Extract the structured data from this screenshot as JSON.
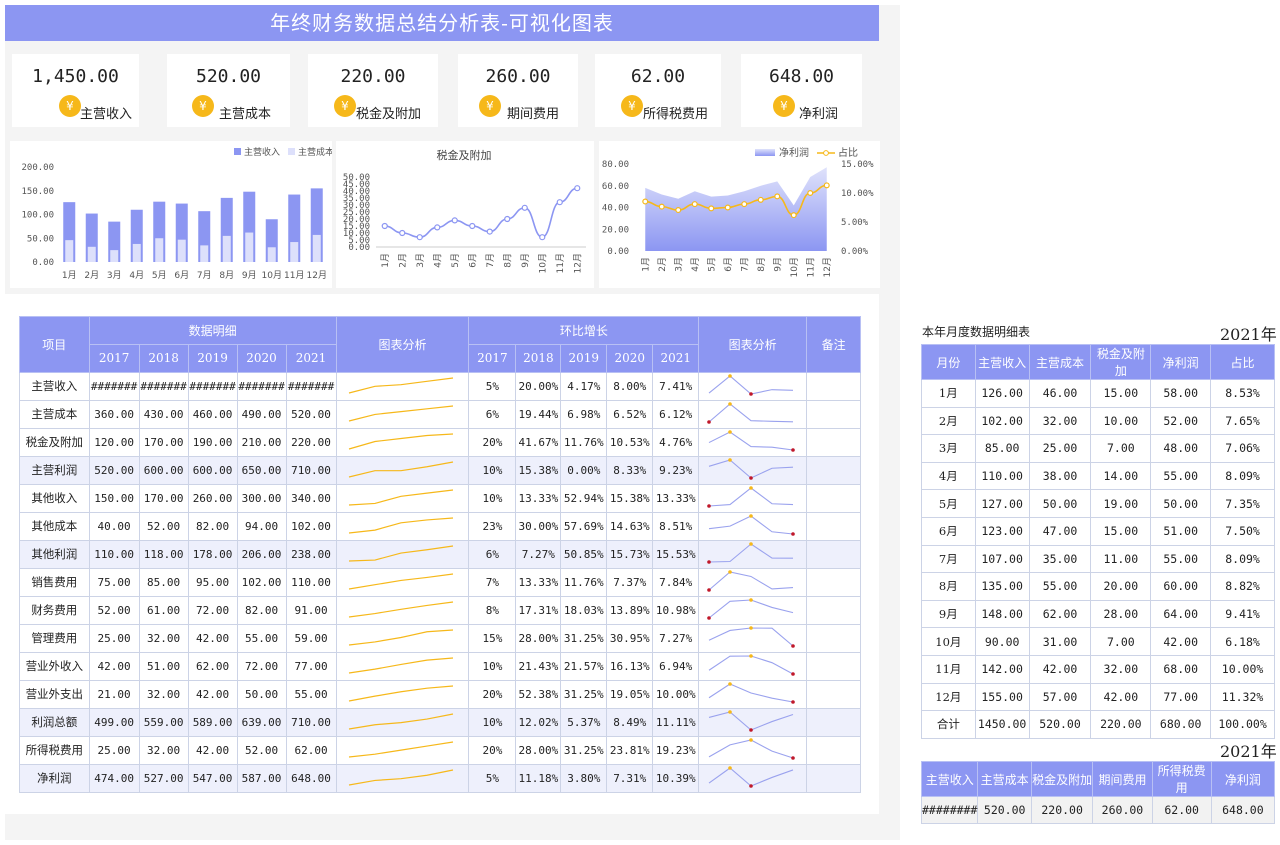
{
  "title": "年终财务数据总结分析表-可视化图表",
  "kpis": [
    {
      "value": "1,450.00",
      "label": "主营收入",
      "icon": "income-icon"
    },
    {
      "value": "520.00",
      "label": "主营成本",
      "icon": "cost-icon"
    },
    {
      "value": "220.00",
      "label": "税金及附加",
      "icon": "tax-icon"
    },
    {
      "value": "260.00",
      "label": "期间费用",
      "icon": "expense-icon"
    },
    {
      "value": "62.00",
      "label": "所得税费用",
      "icon": "income-tax-icon"
    },
    {
      "value": "648.00",
      "label": "净利润",
      "icon": "profit-icon"
    }
  ],
  "colors": {
    "accent": "#8c96f2",
    "bar1": "#8c96f2",
    "bar2": "#dde0fb",
    "line": "#f6b81a",
    "icon": "#f6b81a"
  },
  "chart_data": [
    {
      "type": "bar",
      "categories": [
        "1月",
        "2月",
        "3月",
        "4月",
        "5月",
        "6月",
        "7月",
        "8月",
        "9月",
        "10月",
        "11月",
        "12月"
      ],
      "series": [
        {
          "name": "主营收入",
          "values": [
            126,
            102,
            85,
            110,
            127,
            123,
            107,
            135,
            148,
            90,
            142,
            155
          ]
        },
        {
          "name": "主营成本",
          "values": [
            46,
            32,
            25,
            38,
            50,
            47,
            35,
            55,
            62,
            31,
            42,
            57
          ]
        }
      ],
      "legend_visible": [
        "主营收入",
        "主营成本"
      ],
      "yticks": [
        "0.00",
        "50.00",
        "100.00",
        "150.00",
        "200.00"
      ],
      "ylim": [
        0,
        200
      ],
      "legend": "top-right"
    },
    {
      "type": "line",
      "title": "税金及附加",
      "categories": [
        "1月",
        "2月",
        "3月",
        "4月",
        "5月",
        "6月",
        "7月",
        "8月",
        "9月",
        "10月",
        "11月",
        "12月"
      ],
      "series": [
        {
          "name": "税金及附加",
          "values": [
            15,
            10,
            7,
            14,
            19,
            15,
            11,
            20,
            28,
            7,
            32,
            42
          ]
        }
      ],
      "yticks": [
        "0.00",
        "5.00",
        "10.00",
        "15.00",
        "20.00",
        "25.00",
        "30.00",
        "35.00",
        "40.00",
        "45.00",
        "50.00"
      ],
      "ylim": [
        0,
        50
      ]
    },
    {
      "type": "area",
      "categories": [
        "1月",
        "2月",
        "3月",
        "4月",
        "5月",
        "6月",
        "7月",
        "8月",
        "9月",
        "10月",
        "11月",
        "12月"
      ],
      "series": [
        {
          "name": "净利润",
          "values": [
            58,
            52,
            48,
            55,
            50,
            51,
            55,
            60,
            64,
            42,
            68,
            77
          ]
        },
        {
          "name": "占比",
          "values": [
            8.53,
            7.65,
            7.06,
            8.09,
            7.35,
            7.5,
            8.09,
            8.82,
            9.41,
            6.18,
            10.0,
            11.32
          ]
        }
      ],
      "yticks": [
        "0.00",
        "20.00",
        "40.00",
        "60.00",
        "80.00"
      ],
      "ylim": [
        0,
        80
      ],
      "y2ticks": [
        "0.00%",
        "5.00%",
        "10.00%",
        "15.00%"
      ],
      "y2lim": [
        0,
        15
      ],
      "legend": "top-right"
    }
  ],
  "main_table": {
    "item_header": "项目",
    "detail_header": "数据明细",
    "chart_header": "图表分析",
    "growth_header": "环比增长",
    "chart_header2": "图表分析",
    "note_header": "备注",
    "years": [
      "2017",
      "2018",
      "2019",
      "2020",
      "2021"
    ],
    "rows": [
      {
        "name": "主营收入",
        "vals": [
          "#######",
          "#######",
          "#######",
          "#######",
          "#######"
        ],
        "growth": [
          "5%",
          "20.00%",
          "4.17%",
          "8.00%",
          "7.41%"
        ],
        "spark": [
          1000,
          1200,
          1250,
          1350,
          1450
        ],
        "g": [
          5,
          20,
          4.17,
          8,
          7.41
        ],
        "hl": false
      },
      {
        "name": "主营成本",
        "vals": [
          "360.00",
          "430.00",
          "460.00",
          "490.00",
          "520.00"
        ],
        "growth": [
          "6%",
          "19.44%",
          "6.98%",
          "6.52%",
          "6.12%"
        ],
        "spark": [
          360,
          430,
          460,
          490,
          520
        ],
        "g": [
          6,
          19.44,
          6.98,
          6.52,
          6.12
        ],
        "hl": false
      },
      {
        "name": "税金及附加",
        "vals": [
          "120.00",
          "170.00",
          "190.00",
          "210.00",
          "220.00"
        ],
        "growth": [
          "20%",
          "41.67%",
          "11.76%",
          "10.53%",
          "4.76%"
        ],
        "spark": [
          120,
          170,
          190,
          210,
          220
        ],
        "g": [
          20,
          41.67,
          11.76,
          10.53,
          4.76
        ],
        "hl": false
      },
      {
        "name": "主营利润",
        "vals": [
          "520.00",
          "600.00",
          "600.00",
          "650.00",
          "710.00"
        ],
        "growth": [
          "10%",
          "15.38%",
          "0.00%",
          "8.33%",
          "9.23%"
        ],
        "spark": [
          520,
          600,
          600,
          650,
          710
        ],
        "g": [
          10,
          15.38,
          0,
          8.33,
          9.23
        ],
        "hl": true
      },
      {
        "name": "其他收入",
        "vals": [
          "150.00",
          "170.00",
          "260.00",
          "300.00",
          "340.00"
        ],
        "growth": [
          "10%",
          "13.33%",
          "52.94%",
          "15.38%",
          "13.33%"
        ],
        "spark": [
          150,
          170,
          260,
          300,
          340
        ],
        "g": [
          10,
          13.33,
          52.94,
          15.38,
          13.33
        ],
        "hl": false
      },
      {
        "name": "其他成本",
        "vals": [
          "40.00",
          "52.00",
          "82.00",
          "94.00",
          "102.00"
        ],
        "growth": [
          "23%",
          "30.00%",
          "57.69%",
          "14.63%",
          "8.51%"
        ],
        "spark": [
          40,
          52,
          82,
          94,
          102
        ],
        "g": [
          23,
          30,
          57.69,
          14.63,
          8.51
        ],
        "hl": false
      },
      {
        "name": "其他利润",
        "vals": [
          "110.00",
          "118.00",
          "178.00",
          "206.00",
          "238.00"
        ],
        "growth": [
          "6%",
          "7.27%",
          "50.85%",
          "15.73%",
          "15.53%"
        ],
        "spark": [
          110,
          118,
          178,
          206,
          238
        ],
        "g": [
          6,
          7.27,
          50.85,
          15.73,
          15.53
        ],
        "hl": true
      },
      {
        "name": "销售费用",
        "vals": [
          "75.00",
          "85.00",
          "95.00",
          "102.00",
          "110.00"
        ],
        "growth": [
          "7%",
          "13.33%",
          "11.76%",
          "7.37%",
          "7.84%"
        ],
        "spark": [
          75,
          85,
          95,
          102,
          110
        ],
        "g": [
          7,
          13.33,
          11.76,
          7.37,
          7.84
        ],
        "hl": false
      },
      {
        "name": "财务费用",
        "vals": [
          "52.00",
          "61.00",
          "72.00",
          "82.00",
          "91.00"
        ],
        "growth": [
          "8%",
          "17.31%",
          "18.03%",
          "13.89%",
          "10.98%"
        ],
        "spark": [
          52,
          61,
          72,
          82,
          91
        ],
        "g": [
          8,
          17.31,
          18.03,
          13.89,
          10.98
        ],
        "hl": false
      },
      {
        "name": "管理费用",
        "vals": [
          "25.00",
          "32.00",
          "42.00",
          "55.00",
          "59.00"
        ],
        "growth": [
          "15%",
          "28.00%",
          "31.25%",
          "30.95%",
          "7.27%"
        ],
        "spark": [
          25,
          32,
          42,
          55,
          59
        ],
        "g": [
          15,
          28,
          31.25,
          30.95,
          7.27
        ],
        "hl": false
      },
      {
        "name": "营业外收入",
        "vals": [
          "42.00",
          "51.00",
          "62.00",
          "72.00",
          "77.00"
        ],
        "growth": [
          "10%",
          "21.43%",
          "21.57%",
          "16.13%",
          "6.94%"
        ],
        "spark": [
          42,
          51,
          62,
          72,
          77
        ],
        "g": [
          10,
          21.43,
          21.57,
          16.13,
          6.94
        ],
        "hl": false
      },
      {
        "name": "营业外支出",
        "vals": [
          "21.00",
          "32.00",
          "42.00",
          "50.00",
          "55.00"
        ],
        "growth": [
          "20%",
          "52.38%",
          "31.25%",
          "19.05%",
          "10.00%"
        ],
        "spark": [
          21,
          32,
          42,
          50,
          55
        ],
        "g": [
          20,
          52.38,
          31.25,
          19.05,
          10
        ],
        "hl": false
      },
      {
        "name": "利润总额",
        "vals": [
          "499.00",
          "559.00",
          "589.00",
          "639.00",
          "710.00"
        ],
        "growth": [
          "10%",
          "12.02%",
          "5.37%",
          "8.49%",
          "11.11%"
        ],
        "spark": [
          499,
          559,
          589,
          639,
          710
        ],
        "g": [
          10,
          12.02,
          5.37,
          8.49,
          11.11
        ],
        "hl": true
      },
      {
        "name": "所得税费用",
        "vals": [
          "25.00",
          "32.00",
          "42.00",
          "52.00",
          "62.00"
        ],
        "growth": [
          "20%",
          "28.00%",
          "31.25%",
          "23.81%",
          "19.23%"
        ],
        "spark": [
          25,
          32,
          42,
          52,
          62
        ],
        "g": [
          20,
          28,
          31.25,
          23.81,
          19.23
        ],
        "hl": false
      },
      {
        "name": "净利润",
        "vals": [
          "474.00",
          "527.00",
          "547.00",
          "587.00",
          "648.00"
        ],
        "growth": [
          "5%",
          "11.18%",
          "3.80%",
          "7.31%",
          "10.39%"
        ],
        "spark": [
          474,
          527,
          547,
          587,
          648
        ],
        "g": [
          5,
          11.18,
          3.8,
          7.31,
          10.39
        ],
        "hl": true
      }
    ]
  },
  "monthly": {
    "label": "本年月度数据明细表",
    "year": "2021年",
    "headers": [
      "月份",
      "主营收入",
      "主营成本",
      "税金及附加",
      "净利润",
      "占比"
    ],
    "rows": [
      [
        "1月",
        "126.00",
        "46.00",
        "15.00",
        "58.00",
        "8.53%"
      ],
      [
        "2月",
        "102.00",
        "32.00",
        "10.00",
        "52.00",
        "7.65%"
      ],
      [
        "3月",
        "85.00",
        "25.00",
        "7.00",
        "48.00",
        "7.06%"
      ],
      [
        "4月",
        "110.00",
        "38.00",
        "14.00",
        "55.00",
        "8.09%"
      ],
      [
        "5月",
        "127.00",
        "50.00",
        "19.00",
        "50.00",
        "7.35%"
      ],
      [
        "6月",
        "123.00",
        "47.00",
        "15.00",
        "51.00",
        "7.50%"
      ],
      [
        "7月",
        "107.00",
        "35.00",
        "11.00",
        "55.00",
        "8.09%"
      ],
      [
        "8月",
        "135.00",
        "55.00",
        "20.00",
        "60.00",
        "8.82%"
      ],
      [
        "9月",
        "148.00",
        "62.00",
        "28.00",
        "64.00",
        "9.41%"
      ],
      [
        "10月",
        "90.00",
        "31.00",
        "7.00",
        "42.00",
        "6.18%"
      ],
      [
        "11月",
        "142.00",
        "42.00",
        "32.00",
        "68.00",
        "10.00%"
      ],
      [
        "12月",
        "155.00",
        "57.00",
        "42.00",
        "77.00",
        "11.32%"
      ],
      [
        "合计",
        "1450.00",
        "520.00",
        "220.00",
        "680.00",
        "100.00%"
      ]
    ]
  },
  "summary": {
    "year": "2021年",
    "headers": [
      "主营收入",
      "主营成本",
      "税金及附加",
      "期间费用",
      "所得税费用",
      "净利润"
    ],
    "values": [
      "########",
      "520.00",
      "220.00",
      "260.00",
      "62.00",
      "648.00"
    ]
  }
}
